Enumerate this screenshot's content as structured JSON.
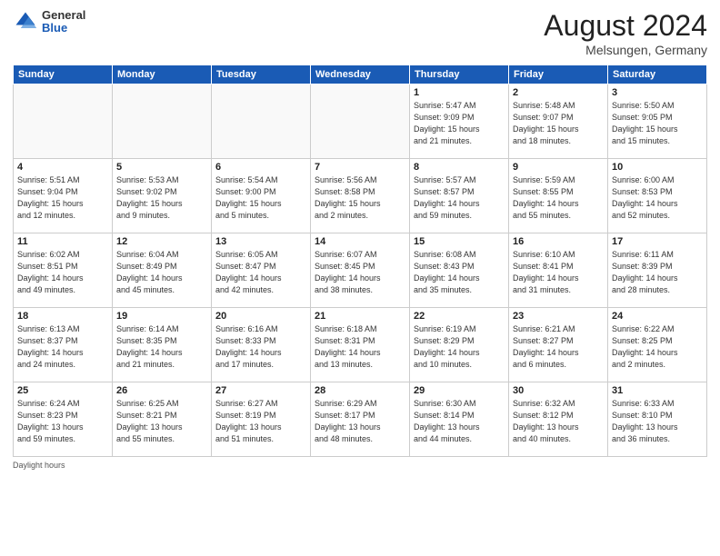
{
  "logo": {
    "general": "General",
    "blue": "Blue"
  },
  "header": {
    "month_year": "August 2024",
    "location": "Melsungen, Germany"
  },
  "days_of_week": [
    "Sunday",
    "Monday",
    "Tuesday",
    "Wednesday",
    "Thursday",
    "Friday",
    "Saturday"
  ],
  "weeks": [
    [
      {
        "day": "",
        "info": ""
      },
      {
        "day": "",
        "info": ""
      },
      {
        "day": "",
        "info": ""
      },
      {
        "day": "",
        "info": ""
      },
      {
        "day": "1",
        "info": "Sunrise: 5:47 AM\nSunset: 9:09 PM\nDaylight: 15 hours\nand 21 minutes."
      },
      {
        "day": "2",
        "info": "Sunrise: 5:48 AM\nSunset: 9:07 PM\nDaylight: 15 hours\nand 18 minutes."
      },
      {
        "day": "3",
        "info": "Sunrise: 5:50 AM\nSunset: 9:05 PM\nDaylight: 15 hours\nand 15 minutes."
      }
    ],
    [
      {
        "day": "4",
        "info": "Sunrise: 5:51 AM\nSunset: 9:04 PM\nDaylight: 15 hours\nand 12 minutes."
      },
      {
        "day": "5",
        "info": "Sunrise: 5:53 AM\nSunset: 9:02 PM\nDaylight: 15 hours\nand 9 minutes."
      },
      {
        "day": "6",
        "info": "Sunrise: 5:54 AM\nSunset: 9:00 PM\nDaylight: 15 hours\nand 5 minutes."
      },
      {
        "day": "7",
        "info": "Sunrise: 5:56 AM\nSunset: 8:58 PM\nDaylight: 15 hours\nand 2 minutes."
      },
      {
        "day": "8",
        "info": "Sunrise: 5:57 AM\nSunset: 8:57 PM\nDaylight: 14 hours\nand 59 minutes."
      },
      {
        "day": "9",
        "info": "Sunrise: 5:59 AM\nSunset: 8:55 PM\nDaylight: 14 hours\nand 55 minutes."
      },
      {
        "day": "10",
        "info": "Sunrise: 6:00 AM\nSunset: 8:53 PM\nDaylight: 14 hours\nand 52 minutes."
      }
    ],
    [
      {
        "day": "11",
        "info": "Sunrise: 6:02 AM\nSunset: 8:51 PM\nDaylight: 14 hours\nand 49 minutes."
      },
      {
        "day": "12",
        "info": "Sunrise: 6:04 AM\nSunset: 8:49 PM\nDaylight: 14 hours\nand 45 minutes."
      },
      {
        "day": "13",
        "info": "Sunrise: 6:05 AM\nSunset: 8:47 PM\nDaylight: 14 hours\nand 42 minutes."
      },
      {
        "day": "14",
        "info": "Sunrise: 6:07 AM\nSunset: 8:45 PM\nDaylight: 14 hours\nand 38 minutes."
      },
      {
        "day": "15",
        "info": "Sunrise: 6:08 AM\nSunset: 8:43 PM\nDaylight: 14 hours\nand 35 minutes."
      },
      {
        "day": "16",
        "info": "Sunrise: 6:10 AM\nSunset: 8:41 PM\nDaylight: 14 hours\nand 31 minutes."
      },
      {
        "day": "17",
        "info": "Sunrise: 6:11 AM\nSunset: 8:39 PM\nDaylight: 14 hours\nand 28 minutes."
      }
    ],
    [
      {
        "day": "18",
        "info": "Sunrise: 6:13 AM\nSunset: 8:37 PM\nDaylight: 14 hours\nand 24 minutes."
      },
      {
        "day": "19",
        "info": "Sunrise: 6:14 AM\nSunset: 8:35 PM\nDaylight: 14 hours\nand 21 minutes."
      },
      {
        "day": "20",
        "info": "Sunrise: 6:16 AM\nSunset: 8:33 PM\nDaylight: 14 hours\nand 17 minutes."
      },
      {
        "day": "21",
        "info": "Sunrise: 6:18 AM\nSunset: 8:31 PM\nDaylight: 14 hours\nand 13 minutes."
      },
      {
        "day": "22",
        "info": "Sunrise: 6:19 AM\nSunset: 8:29 PM\nDaylight: 14 hours\nand 10 minutes."
      },
      {
        "day": "23",
        "info": "Sunrise: 6:21 AM\nSunset: 8:27 PM\nDaylight: 14 hours\nand 6 minutes."
      },
      {
        "day": "24",
        "info": "Sunrise: 6:22 AM\nSunset: 8:25 PM\nDaylight: 14 hours\nand 2 minutes."
      }
    ],
    [
      {
        "day": "25",
        "info": "Sunrise: 6:24 AM\nSunset: 8:23 PM\nDaylight: 13 hours\nand 59 minutes."
      },
      {
        "day": "26",
        "info": "Sunrise: 6:25 AM\nSunset: 8:21 PM\nDaylight: 13 hours\nand 55 minutes."
      },
      {
        "day": "27",
        "info": "Sunrise: 6:27 AM\nSunset: 8:19 PM\nDaylight: 13 hours\nand 51 minutes."
      },
      {
        "day": "28",
        "info": "Sunrise: 6:29 AM\nSunset: 8:17 PM\nDaylight: 13 hours\nand 48 minutes."
      },
      {
        "day": "29",
        "info": "Sunrise: 6:30 AM\nSunset: 8:14 PM\nDaylight: 13 hours\nand 44 minutes."
      },
      {
        "day": "30",
        "info": "Sunrise: 6:32 AM\nSunset: 8:12 PM\nDaylight: 13 hours\nand 40 minutes."
      },
      {
        "day": "31",
        "info": "Sunrise: 6:33 AM\nSunset: 8:10 PM\nDaylight: 13 hours\nand 36 minutes."
      }
    ]
  ],
  "footer": {
    "note": "Daylight hours"
  }
}
